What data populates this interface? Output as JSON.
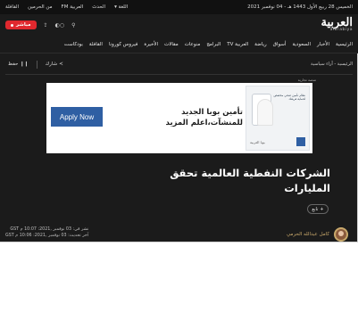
{
  "topbar": {
    "date": "الخميس 28 ربيع الأول 1443 هـ - 04 نوفمبر 2021",
    "links": [
      "القافلة",
      "من الحرمين",
      "العربية FM",
      "الحدث",
      "اللغة ▾"
    ]
  },
  "brand": {
    "logo_ar": "العربية",
    "logo_en": "alarabiya",
    "live_label": "مباشر",
    "icons": [
      "share-icon",
      "dark-mode-toggle-icon",
      "search-icon"
    ]
  },
  "nav": {
    "items": [
      "الرئيسية",
      "الأخبار",
      "السعودية",
      "أسواق",
      "رياضة",
      "العربية TV",
      "البرامج",
      "منوعات",
      "مقالات",
      "الأخيرة",
      "فيروس كورونا",
      "القافلة",
      "بودكاست"
    ]
  },
  "article_tools": {
    "share_label": "شارك",
    "save_label": "حفظ"
  },
  "breadcrumb": "الرئيسية - آراء سياسية",
  "ad": {
    "label": "منصة تجارية",
    "cta": "Apply Now",
    "headline_line1": "تأمين بوبا الجديد",
    "headline_line2": "للمنشآت،اعلم المزيد",
    "img_headline": "نظام تأمين صحي مخصص لحماية فريقك",
    "img_footer": "بوبا العربية"
  },
  "article": {
    "title": "الشركات النفطية العالمية تحقق المليارات",
    "follow_label": "تابع"
  },
  "author": {
    "name": "كامل عبدالله الحرمي",
    "published": "نشر في: 03 نوفمبر ,2021: 10:07 م GST",
    "updated": "آخر تحديث: 03 نوفمبر ,2021: 10:06 م GST"
  },
  "colors": {
    "background": "#1b1b1b",
    "live_red": "#e0282e",
    "ad_button": "#2f5fa3",
    "author_gold": "#c8a86b"
  }
}
